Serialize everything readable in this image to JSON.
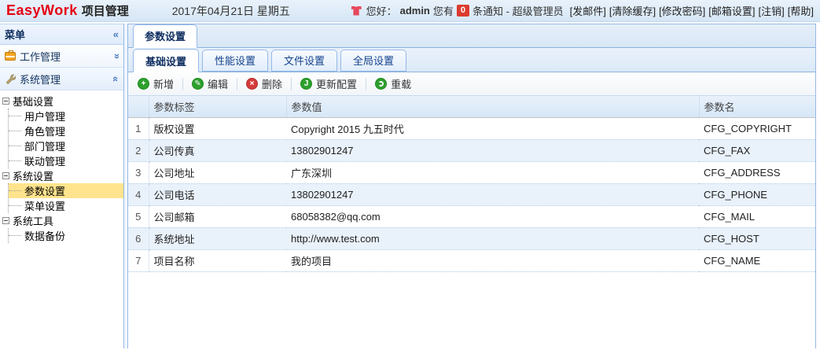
{
  "colors": {
    "brand_red": "#e60012",
    "panel_border": "#95b8e7",
    "selected_yellow": "#ffe48d",
    "badge_red": "#dd3a2f",
    "icon_green": "#2da02d",
    "icon_red": "#d43b3b"
  },
  "header": {
    "logo_primary": "EasyWork",
    "logo_secondary": "项目管理",
    "date": "2017年04月21日 星期五",
    "greeting": "您好：",
    "username": "admin",
    "notice_before": "您有",
    "notice_count": "0",
    "notice_after": "条通知 - 超级管理员",
    "links": [
      "[发邮件]",
      "[清除缓存]",
      "[修改密码]",
      "[邮箱设置]",
      "[注销]",
      "[帮助]"
    ]
  },
  "sidebar": {
    "title": "菜单",
    "collapse_icon": "«",
    "accordions": [
      {
        "label": "工作管理",
        "expanded": false
      },
      {
        "label": "系统管理",
        "expanded": true
      }
    ],
    "tree": [
      {
        "label": "基础设置",
        "level": 0
      },
      {
        "label": "用户管理",
        "level": 1
      },
      {
        "label": "角色管理",
        "level": 1
      },
      {
        "label": "部门管理",
        "level": 1
      },
      {
        "label": "联动管理",
        "level": 1
      },
      {
        "label": "系统设置",
        "level": 0
      },
      {
        "label": "参数设置",
        "level": 1,
        "selected": true
      },
      {
        "label": "菜单设置",
        "level": 1
      },
      {
        "label": "系统工具",
        "level": 0
      },
      {
        "label": "数据备份",
        "level": 1
      }
    ]
  },
  "main": {
    "panel_tab": "参数设置",
    "subtabs": [
      "基础设置",
      "性能设置",
      "文件设置",
      "全局设置"
    ],
    "active_subtab": "基础设置",
    "toolbar": [
      {
        "label": "新增",
        "icon": "plus-icon"
      },
      {
        "label": "编辑",
        "icon": "pencil-icon"
      },
      {
        "label": "删除",
        "icon": "delete-icon"
      },
      {
        "label": "更新配置",
        "icon": "update-icon"
      },
      {
        "label": "重载",
        "icon": "reload-icon"
      }
    ],
    "table": {
      "columns": [
        "参数标签",
        "参数值",
        "参数名"
      ],
      "rows": [
        {
          "num": "1",
          "label": "版权设置",
          "value": "Copyright 2015 九五时代",
          "name": "CFG_COPYRIGHT"
        },
        {
          "num": "2",
          "label": "公司传真",
          "value": "13802901247",
          "name": "CFG_FAX"
        },
        {
          "num": "3",
          "label": "公司地址",
          "value": "广东深圳",
          "name": "CFG_ADDRESS"
        },
        {
          "num": "4",
          "label": "公司电话",
          "value": "13802901247",
          "name": "CFG_PHONE"
        },
        {
          "num": "5",
          "label": "公司邮箱",
          "value": "68058382@qq.com",
          "name": "CFG_MAIL"
        },
        {
          "num": "6",
          "label": "系统地址",
          "value": "http://www.test.com",
          "name": "CFG_HOST"
        },
        {
          "num": "7",
          "label": "项目名称",
          "value": "我的项目",
          "name": "CFG_NAME"
        }
      ]
    }
  }
}
